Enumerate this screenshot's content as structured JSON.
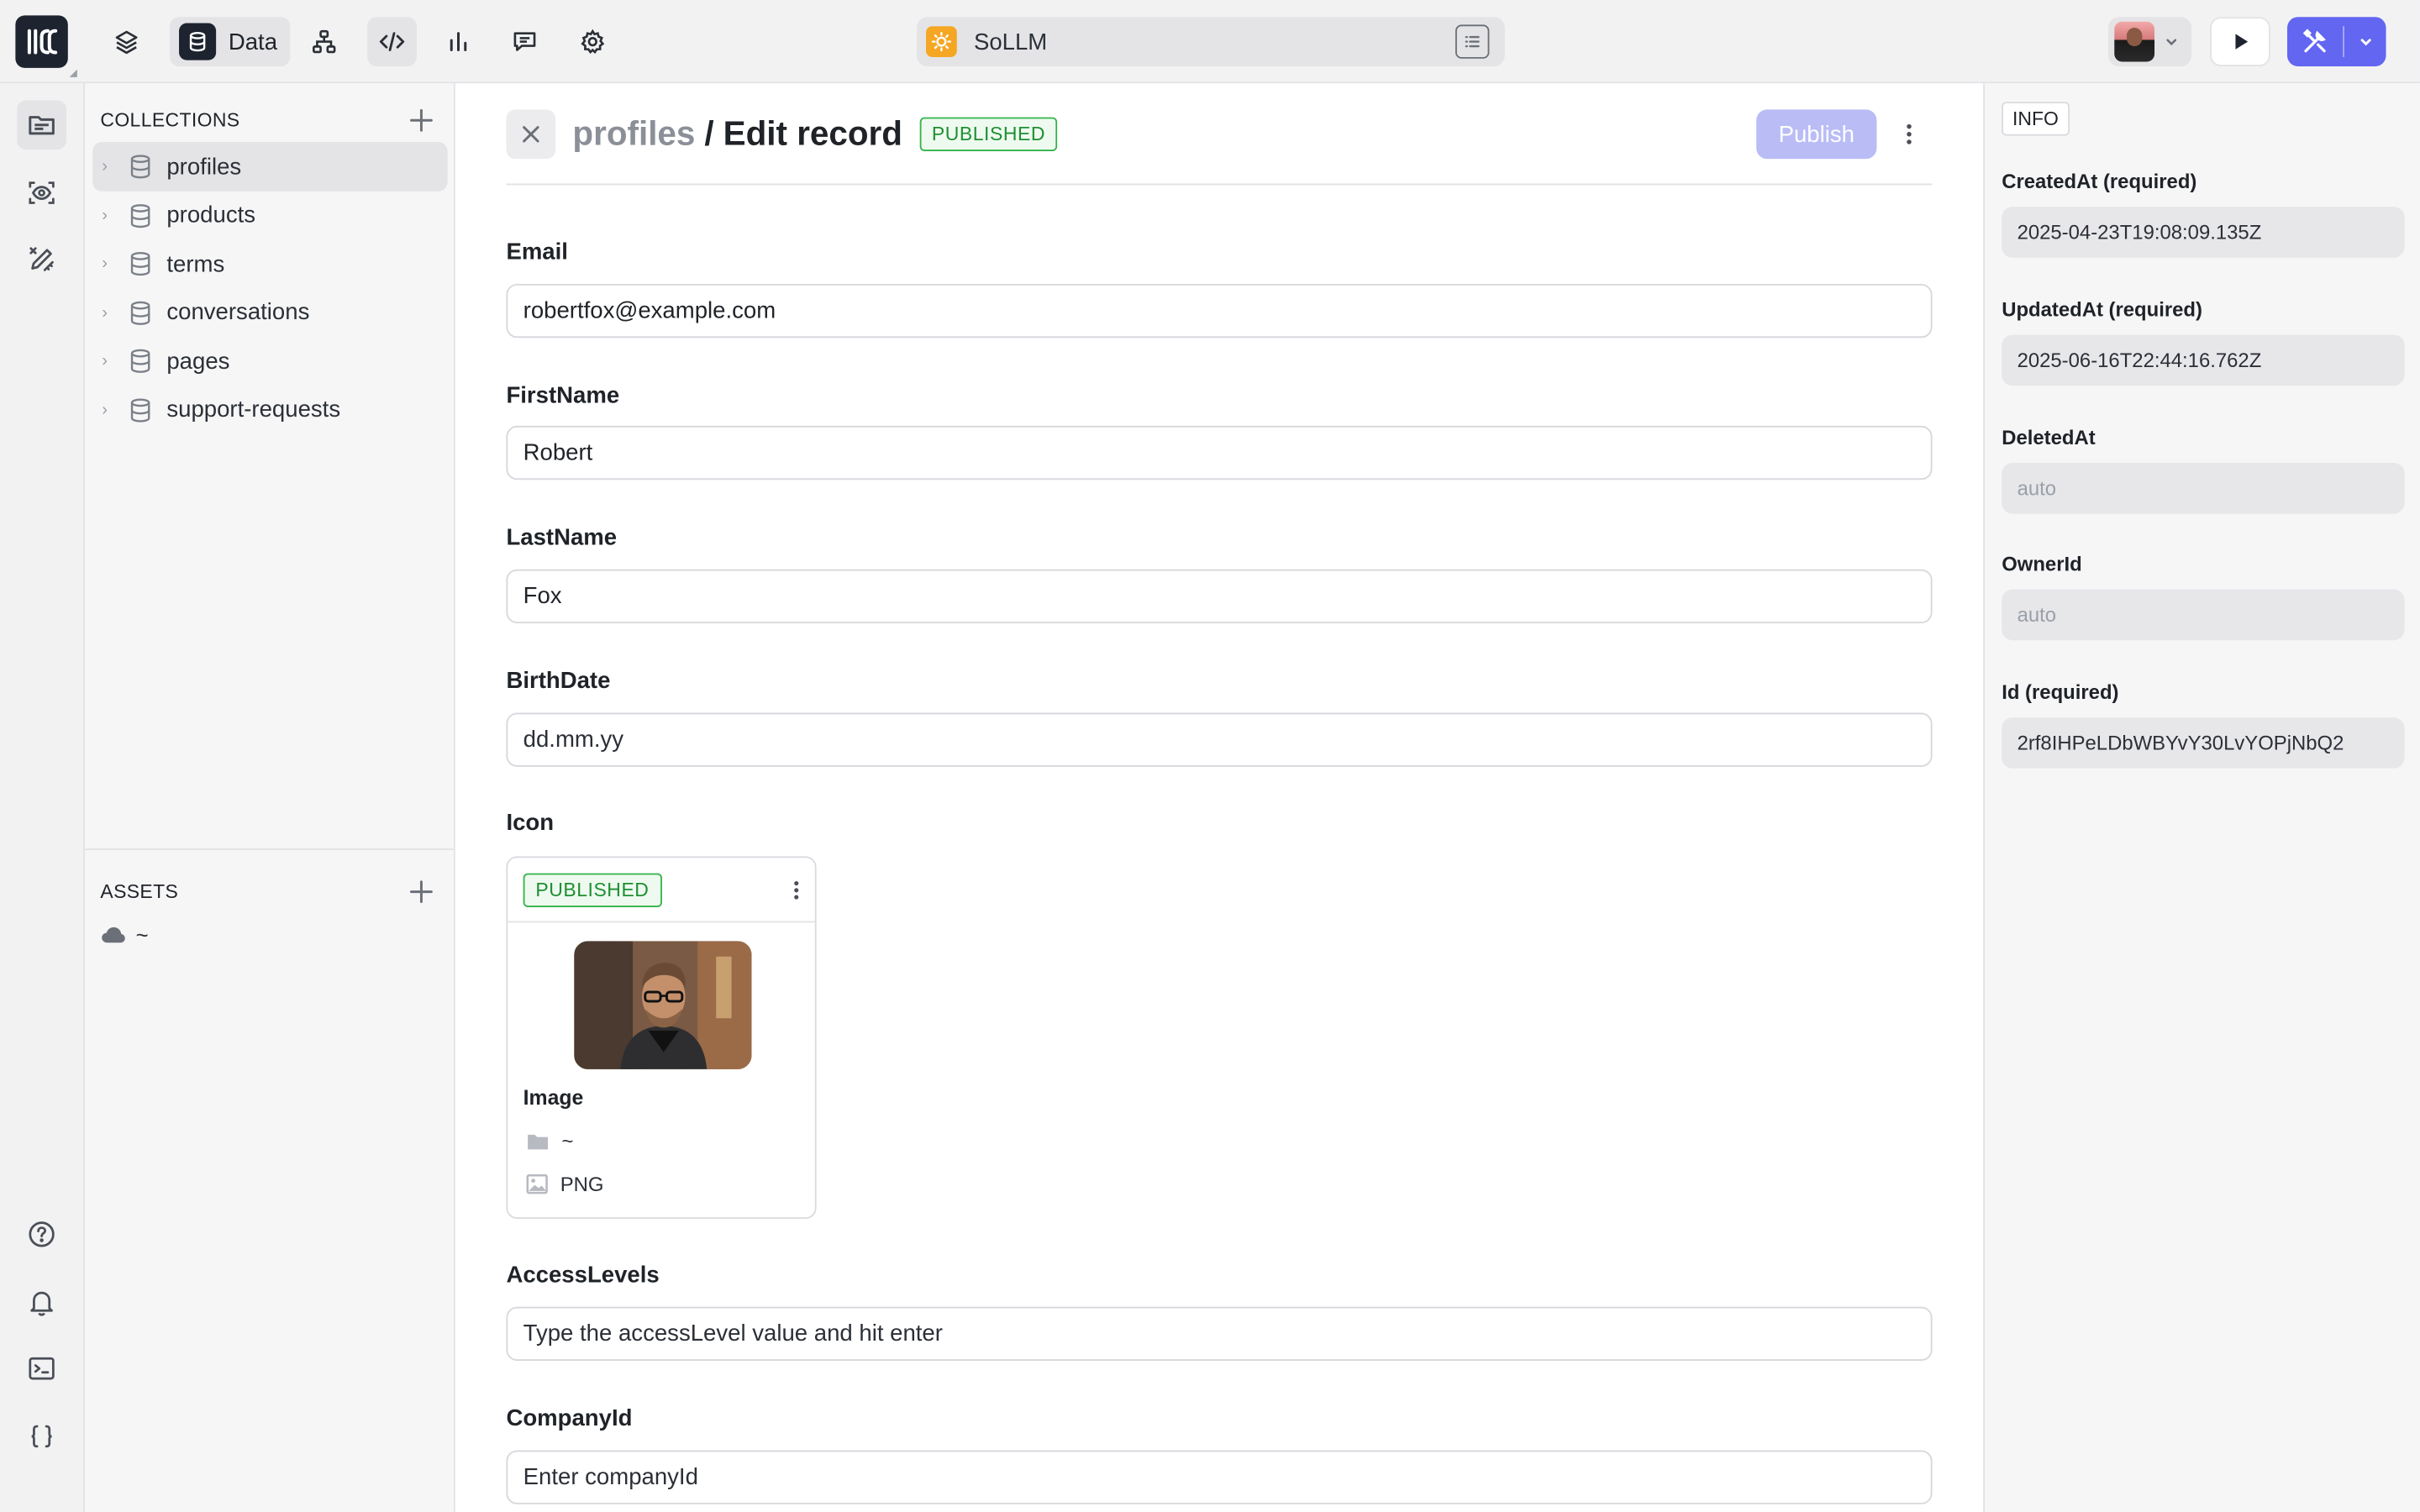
{
  "toolbar": {
    "data_label": "Data"
  },
  "project": {
    "name": "SoLLM"
  },
  "sidebar": {
    "collections_title": "COLLECTIONS",
    "collections": [
      {
        "label": "profiles",
        "selected": true
      },
      {
        "label": "products",
        "selected": false
      },
      {
        "label": "terms",
        "selected": false
      },
      {
        "label": "conversations",
        "selected": false
      },
      {
        "label": "pages",
        "selected": false
      },
      {
        "label": "support-requests",
        "selected": false
      }
    ],
    "assets_title": "ASSETS",
    "assets_root": "~"
  },
  "editor": {
    "collection": "profiles",
    "separator": "/",
    "page_title": "Edit record",
    "status_badge": "PUBLISHED",
    "publish_label": "Publish",
    "fields": {
      "email_label": "Email",
      "email_value": "robertfox@example.com",
      "firstname_label": "FirstName",
      "firstname_value": "Robert",
      "lastname_label": "LastName",
      "lastname_value": "Fox",
      "birthdate_label": "BirthDate",
      "birthdate_placeholder": "dd.mm.yy",
      "icon_label": "Icon",
      "accesslevels_label": "AccessLevels",
      "accesslevels_placeholder": "Type the accessLevel value and hit enter",
      "companyid_label": "CompanyId",
      "companyid_placeholder": "Enter companyId"
    },
    "asset_card": {
      "status_badge": "PUBLISHED",
      "title": "Image",
      "folder": "~",
      "format": "PNG"
    }
  },
  "info": {
    "tab_label": "INFO",
    "fields": [
      {
        "label": "CreatedAt (required)",
        "value": "2025-04-23T19:08:09.135Z",
        "muted": false
      },
      {
        "label": "UpdatedAt (required)",
        "value": "2025-06-16T22:44:16.762Z",
        "muted": false
      },
      {
        "label": "DeletedAt",
        "value": "auto",
        "muted": true
      },
      {
        "label": "OwnerId",
        "value": "auto",
        "muted": true
      },
      {
        "label": "Id (required)",
        "value": "2rf8IHPeLDbWBYvY30LvYOPjNbQ2",
        "muted": false
      }
    ]
  },
  "colors": {
    "accent": "#6366f1",
    "publish_disabled": "#b9bcf5",
    "badge_green": "#1f8f32",
    "project_icon": "#f5a623"
  }
}
